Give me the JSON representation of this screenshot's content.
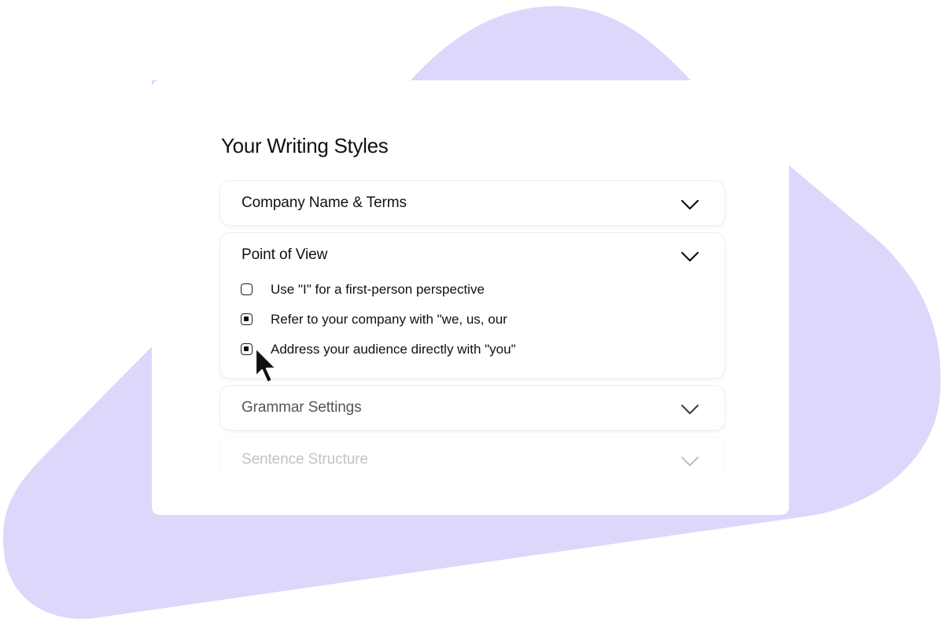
{
  "panel": {
    "title": "Your Writing Styles"
  },
  "sections": [
    {
      "label": "Company Name & Terms",
      "expanded": false
    },
    {
      "label": "Point of View",
      "expanded": true,
      "options": [
        {
          "label": "Use \"I\" for a first-person perspective",
          "checked": false
        },
        {
          "label": "Refer to your company with \"we, us, our",
          "checked": true
        },
        {
          "label": "Address your audience directly with \"you\"",
          "checked": true
        }
      ]
    },
    {
      "label": "Grammar Settings",
      "expanded": false
    },
    {
      "label": "Sentence Structure",
      "expanded": false
    }
  ],
  "icons": {
    "chevron": "chevron-down-icon",
    "cursor": "mouse-pointer-icon"
  },
  "colors": {
    "background_blob": "#dcd7fb",
    "card": "#ffffff",
    "text": "#111111"
  }
}
